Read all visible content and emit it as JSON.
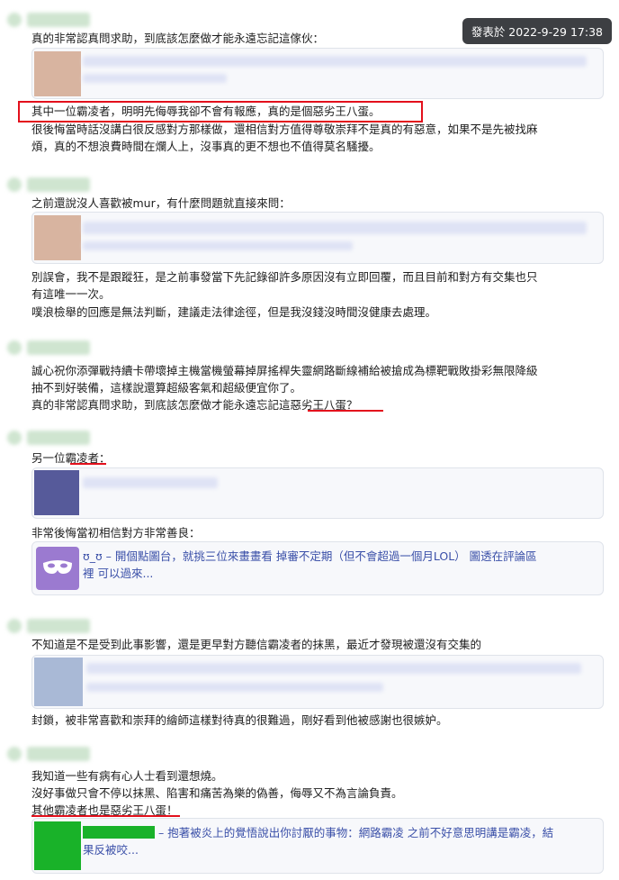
{
  "tooltip": "發表於 2022-9-29 17:38",
  "posts": [
    {
      "line1": "真的非常認真問求助，到底該怎麼做才能永遠忘記這傢伙：",
      "highlight": "其中一位霸凌者，明明先侮辱我卻不會有報應，真的是個惡劣王八蛋。",
      "line2": "很後悔當時話沒講白很反感對方那樣做，還相信對方值得尊敬崇拜不是真的有惡意，如果不是先被找麻",
      "line3": "煩，真的不想浪費時間在爛人上，沒事真的更不想也不值得莫名騷擾。"
    },
    {
      "line1": "之前還說沒人喜歡被mur，有什麼問題就直接來問：",
      "line2": "別誤會，我不是跟蹤狂，是之前事發當下先記錄卻許多原因沒有立即回覆，而且目前和對方有交集也只",
      "line3": "有這唯一一次。",
      "line4": "噗浪檢舉的回應是無法判斷，建議走法律途徑，但是我沒錢沒時間沒健康去處理。"
    },
    {
      "line1": "誠心祝你添彈戰持續卡帶壞掉主機當機螢幕掉屏搖桿失靈網路斷線補給被搶成為標靶戰敗掛彩無限降級",
      "line2": "抽不到好裝備，這樣說還算超級客氣和超級便宜你了。",
      "line3": "真的非常認真問求助，到底該怎麼做才能永遠忘記這惡劣王八蛋？"
    },
    {
      "line1": "另一位霸凌者：",
      "line2": "非常後悔當初相信對方非常善良：",
      "card_link": "ʊ_ʊ – 開個點圖台，就挑三位來畫畫看 掉審不定期（但不會超過一個月LOL） 圖透在評論區",
      "card_link2": "裡 可以過來..."
    },
    {
      "line1": "不知道是不是受到此事影響，還是更早對方聽信霸凌者的抹黑，最近才發現被還沒有交集的",
      "line2": "封鎖，被非常喜歡和崇拜的繪師這樣對待真的很難過，剛好看到他被感謝也很嫉妒。"
    },
    {
      "line1": "我知道一些有病有心人士看到還想燒。",
      "line2": "沒好事做只會不停以抹黑、陷害和痛苦為樂的偽善，侮辱又不為言論負責。",
      "line3": "其他霸凌者也是惡劣王八蛋！",
      "card_link": "– 抱著被炎上的覺悟說出你討厭的事物：網路霸凌 之前不好意思明講是霸凌，結",
      "card_link2": "果反被咬..."
    }
  ],
  "colors": {
    "accent_red": "#e3101c",
    "link": "#3a4fa8",
    "tooltip_bg": "#3d3f43"
  }
}
